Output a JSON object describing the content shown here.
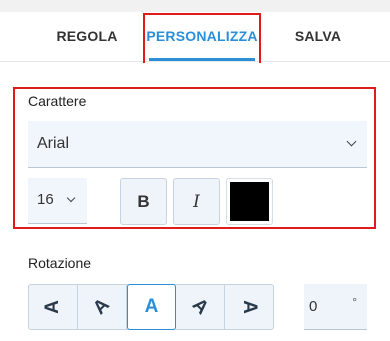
{
  "tabs": [
    {
      "label": "REGOLA"
    },
    {
      "label": "PERSONALIZZA"
    },
    {
      "label": "SALVA"
    }
  ],
  "active_tab": "PERSONALIZZA",
  "accent_color": "#2a8fd8",
  "highlight_color": "#e01b1b",
  "font_section": {
    "label": "Carattere",
    "font_family": "Arial",
    "font_size": "16",
    "bold_label": "B",
    "italic_label": "I",
    "text_color": "#000000"
  },
  "rotation_section": {
    "label": "Rotazione",
    "options": [
      {
        "glyph": "A",
        "icon": "text-rotate-90-left-icon"
      },
      {
        "glyph": "A",
        "icon": "text-rotate-45-left-icon"
      },
      {
        "glyph": "A",
        "icon": "text-rotate-0-icon",
        "selected": true
      },
      {
        "glyph": "A",
        "icon": "text-rotate-45-right-icon"
      },
      {
        "glyph": "A",
        "icon": "text-rotate-90-right-icon"
      }
    ],
    "value": "0",
    "unit": "°"
  }
}
